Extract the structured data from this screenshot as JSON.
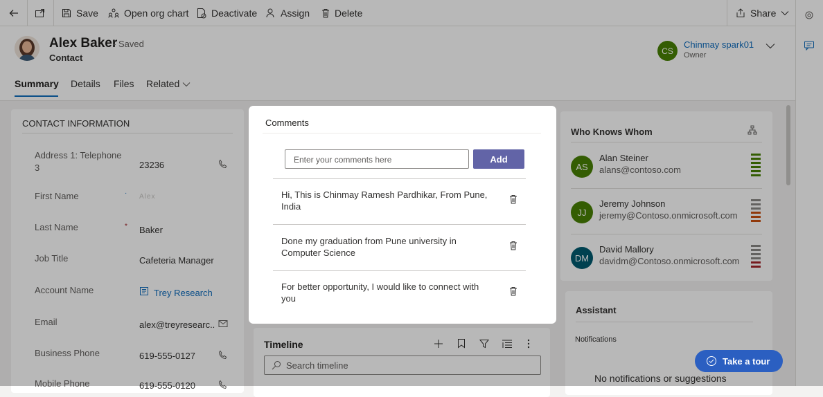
{
  "toolbar": {
    "save": "Save",
    "org_chart": "Open org chart",
    "deactivate": "Deactivate",
    "assign": "Assign",
    "delete": "Delete",
    "share": "Share"
  },
  "header": {
    "name": "Alex Baker",
    "saved": "- Saved",
    "entity": "Contact",
    "owner_initials": "CS",
    "owner_name": "Chinmay spark01",
    "owner_role": "Owner"
  },
  "tabs": [
    "Summary",
    "Details",
    "Files",
    "Related"
  ],
  "contact": {
    "section_title": "CONTACT INFORMATION",
    "fields": [
      {
        "label": "Address 1: Telephone 3",
        "value": "23236"
      },
      {
        "label": "First Name",
        "value": "Alex"
      },
      {
        "label": "Last Name",
        "value": "Baker"
      },
      {
        "label": "Job Title",
        "value": "Cafeteria Manager"
      },
      {
        "label": "Account Name",
        "value": "Trey Research"
      },
      {
        "label": "Email",
        "value": "alex@treyresearc..."
      },
      {
        "label": "Business Phone",
        "value": "619-555-0127"
      },
      {
        "label": "Mobile Phone",
        "value": "619-555-0120"
      }
    ]
  },
  "comments": {
    "title": "Comments",
    "placeholder": "Enter your comments here",
    "add_label": "Add",
    "items": [
      "Hi, This is Chinmay Ramesh Pardhikar, From Pune, India",
      "Done my graduation from Pune university in Computer Science",
      "For better opportunity, I would like to connect with you"
    ]
  },
  "timeline": {
    "title": "Timeline",
    "search_placeholder": "Search timeline"
  },
  "who_knows": {
    "title": "Who Knows Whom",
    "people": [
      {
        "initials": "AS",
        "name": "Alan Steiner",
        "email": "alans@contoso.com",
        "color": "#498205"
      },
      {
        "initials": "JJ",
        "name": "Jeremy Johnson",
        "email": "jeremy@Contoso.onmicrosoft.com",
        "color": "#498205"
      },
      {
        "initials": "DM",
        "name": "David Mallory",
        "email": "davidm@Contoso.onmicrosoft.com",
        "color": "#005b70"
      }
    ]
  },
  "assistant": {
    "title": "Assistant",
    "notifications": "Notifications",
    "empty": "No notifications or suggestions"
  },
  "tour": {
    "label": "Take a tour"
  }
}
